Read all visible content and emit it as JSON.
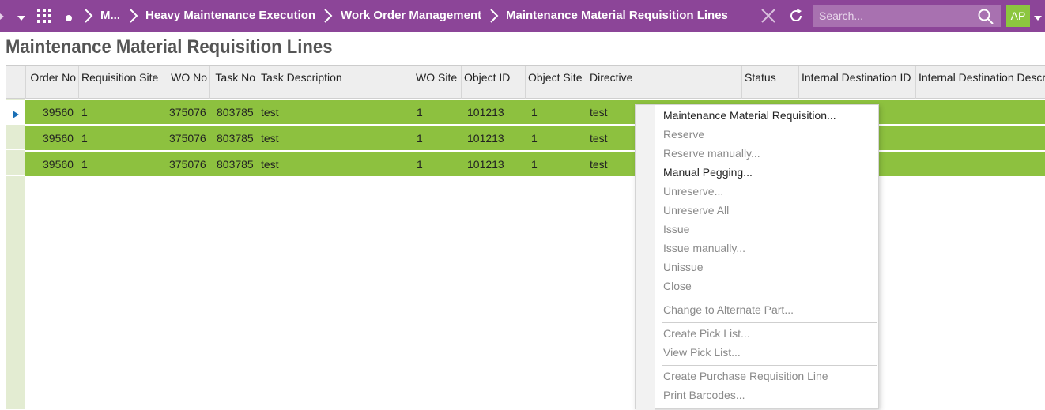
{
  "topbar": {
    "breadcrumbs": [
      "M...",
      "Heavy Maintenance Execution",
      "Work Order Management",
      "Maintenance Material Requisition Lines"
    ],
    "search_placeholder": "Search...",
    "user_initials": "AP",
    "colors": {
      "bar": "#8c4598",
      "search": "#a871b0",
      "avatar": "#8cc63f"
    }
  },
  "page": {
    "title": "Maintenance Material Requisition Lines"
  },
  "grid": {
    "columns": [
      "Order No",
      "Requisition Site",
      "WO No",
      "Task No",
      "Task Description",
      "WO Site",
      "Object ID",
      "Object Site",
      "Directive",
      "Status",
      "Internal Destination ID",
      "Internal Destination Descr"
    ],
    "rows": [
      {
        "order_no": "39560",
        "requisition_site": "1",
        "wo_no": "375076",
        "task_no": "803785",
        "task_description": "test",
        "wo_site": "1",
        "object_id": "101213",
        "object_site": "1",
        "directive": "test"
      },
      {
        "order_no": "39560",
        "requisition_site": "1",
        "wo_no": "375076",
        "task_no": "803785",
        "task_description": "test",
        "wo_site": "1",
        "object_id": "101213",
        "object_site": "1",
        "directive": "test"
      },
      {
        "order_no": "39560",
        "requisition_site": "1",
        "wo_no": "375076",
        "task_no": "803785",
        "task_description": "test",
        "wo_site": "1",
        "object_id": "101213",
        "object_site": "1",
        "directive": "test"
      }
    ],
    "row_color": "#8dc13f"
  },
  "context_menu": {
    "items": [
      {
        "label": "Maintenance Material Requisition...",
        "enabled": true
      },
      {
        "label": "Reserve",
        "enabled": false
      },
      {
        "label": "Reserve manually...",
        "enabled": false
      },
      {
        "label": "Manual Pegging...",
        "enabled": true
      },
      {
        "label": "Unreserve...",
        "enabled": false
      },
      {
        "label": "Unreserve All",
        "enabled": false
      },
      {
        "label": "Issue",
        "enabled": false
      },
      {
        "label": "Issue manually...",
        "enabled": false
      },
      {
        "label": "Unissue",
        "enabled": false
      },
      {
        "label": "Close",
        "enabled": false
      },
      {
        "label": "Change to Alternate Part...",
        "enabled": false
      },
      {
        "label": "Create Pick List...",
        "enabled": false
      },
      {
        "label": "View Pick List...",
        "enabled": false
      },
      {
        "label": "Create Purchase Requisition Line",
        "enabled": false
      },
      {
        "label": "Print Barcodes...",
        "enabled": false
      }
    ]
  },
  "icons": [
    "caret-down-icon",
    "app-grid-icon",
    "dot-icon",
    "chevron-right-icon",
    "close-icon",
    "refresh-icon",
    "search-icon",
    "dropdown-icon",
    "row-selected-arrow-icon"
  ]
}
